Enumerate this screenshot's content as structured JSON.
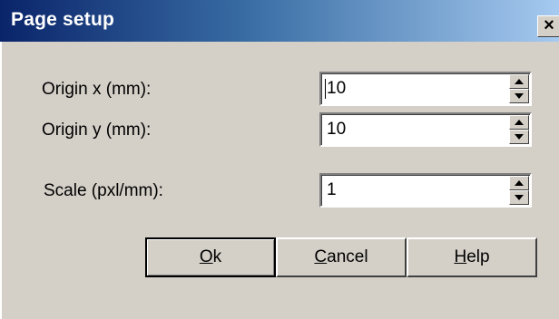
{
  "dialog": {
    "title": "Page setup",
    "close_glyph": "✕"
  },
  "fields": {
    "origin_x": {
      "label": "Origin x (mm):",
      "value": "10"
    },
    "origin_y": {
      "label": "Origin y (mm):",
      "value": "10"
    },
    "scale": {
      "label": "Scale (pxl/mm):",
      "value": "1"
    }
  },
  "buttons": {
    "ok": {
      "accel": "O",
      "rest": "k"
    },
    "cancel": {
      "accel": "C",
      "rest": "ancel"
    },
    "help": {
      "accel": "H",
      "rest": "elp"
    }
  },
  "icons": {
    "spin_up": "spin-up-arrow-icon",
    "spin_down": "spin-down-arrow-icon",
    "close": "close-icon"
  },
  "colors": {
    "title_start": "#0a246a",
    "title_end": "#a6caf0",
    "face": "#d4d0c8"
  }
}
